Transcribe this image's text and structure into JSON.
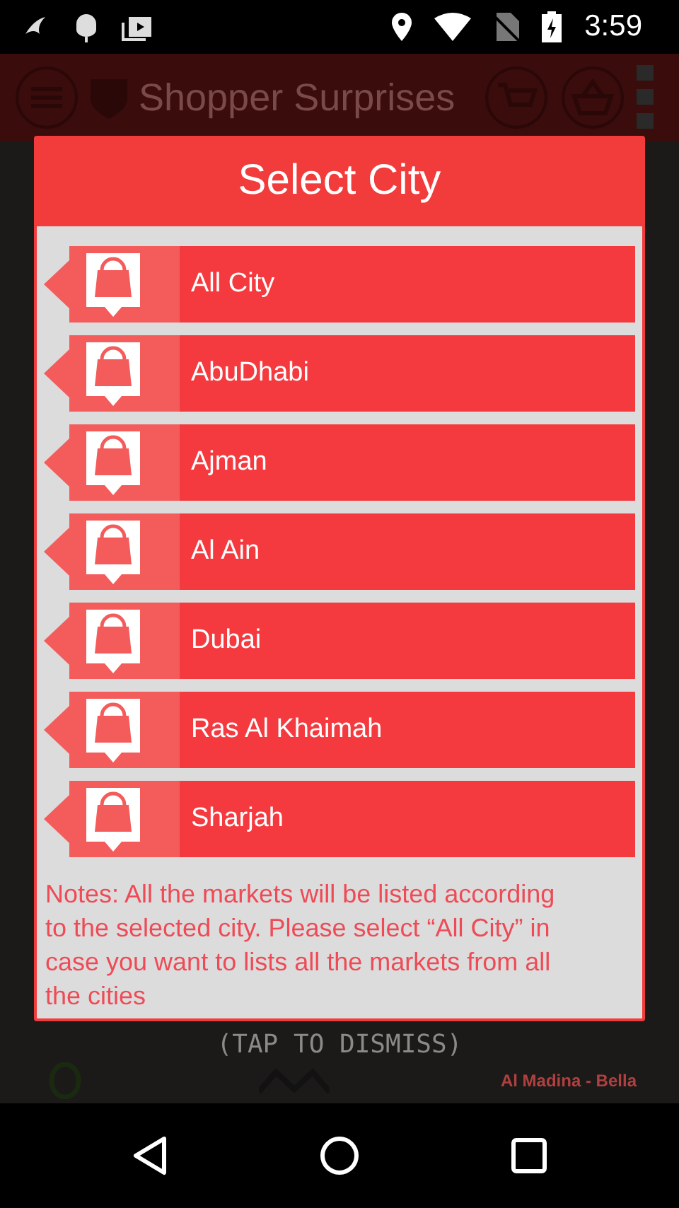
{
  "status_bar": {
    "time": "3:59"
  },
  "app_bar": {
    "title": "Shopper Surprises"
  },
  "background": {
    "hint": "(TAP TO DISMISS)",
    "store_label": "Al Madina - Bella"
  },
  "dialog": {
    "title": "Select City",
    "cities": [
      {
        "label": "All City"
      },
      {
        "label": "AbuDhabi"
      },
      {
        "label": "Ajman"
      },
      {
        "label": "Al Ain"
      },
      {
        "label": "Dubai"
      },
      {
        "label": "Ras Al Khaimah"
      },
      {
        "label": "Sharjah"
      }
    ],
    "note": "Notes: All the markets will be listed according to the selected city. Please select “All City” in case you want to lists all the markets from all the cities"
  }
}
